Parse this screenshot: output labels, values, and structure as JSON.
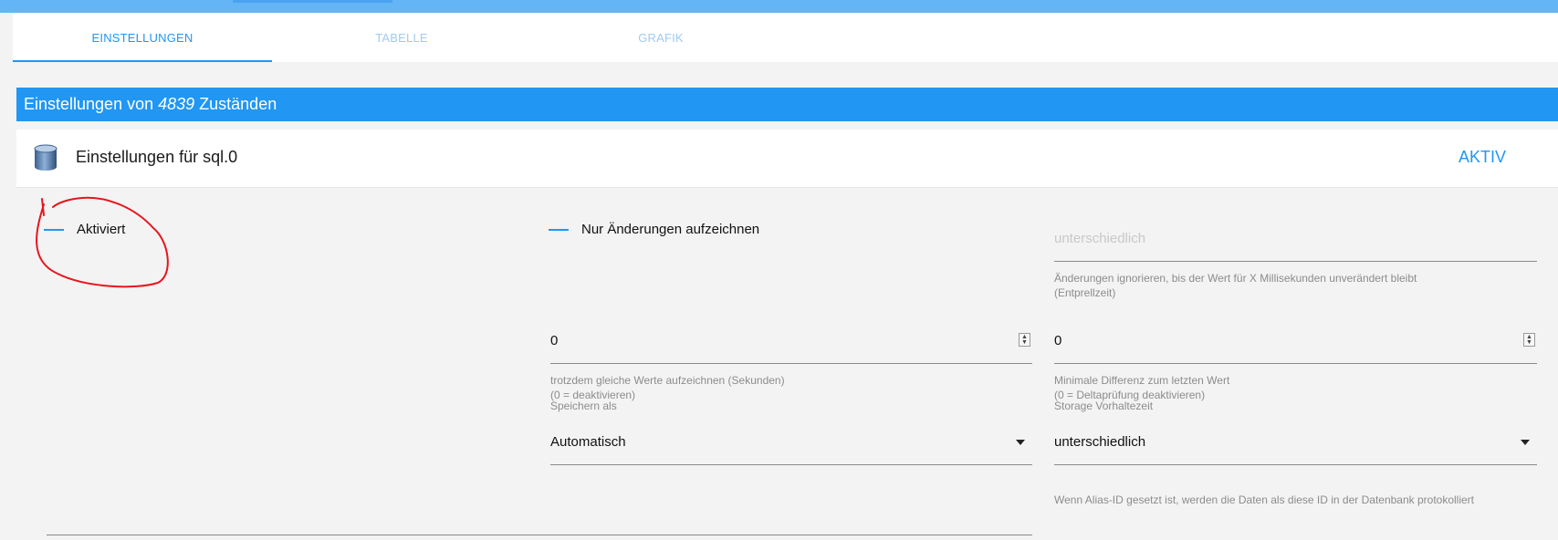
{
  "tabs": [
    {
      "label": "EINSTELLUNGEN",
      "active": true
    },
    {
      "label": "TABELLE",
      "active": false
    },
    {
      "label": "GRAFIK",
      "active": false
    }
  ],
  "section": {
    "prefix": "Einstellungen von",
    "count": "4839",
    "suffix": "Zuständen"
  },
  "card": {
    "title": "Einstellungen für sql.0",
    "status": "AKTIV",
    "icon": "database-icon"
  },
  "settings": {
    "enabled_label": "Aktiviert",
    "changes_only_label": "Nur Änderungen aufzeichnen",
    "debounce": {
      "placeholder": "unterschiedlich",
      "help": "Änderungen ignorieren, bis der Wert für X Millisekunden unverändert bleibt",
      "help2": "(Entprellzeit)"
    },
    "record_same_values": {
      "value": "0",
      "help": "trotzdem gleiche Werte aufzeichnen (Sekunden)",
      "help2": "(0 = deaktivieren)"
    },
    "min_difference": {
      "value": "0",
      "help": "Minimale Differenz zum letzten Wert",
      "help2": "(0 = Deltaprüfung deaktivieren)"
    },
    "store_as": {
      "label": "Speichern als",
      "value": "Automatisch"
    },
    "retention": {
      "label": "Storage Vorhaltezeit",
      "value": "unterschiedlich"
    },
    "alias_help": "Wenn Alias-ID gesetzt ist, werden die Daten als diese ID in der Datenbank protokolliert"
  },
  "colors": {
    "accent": "#2196f3",
    "topbar": "#64b5f6",
    "annotation": "#e8141e"
  }
}
